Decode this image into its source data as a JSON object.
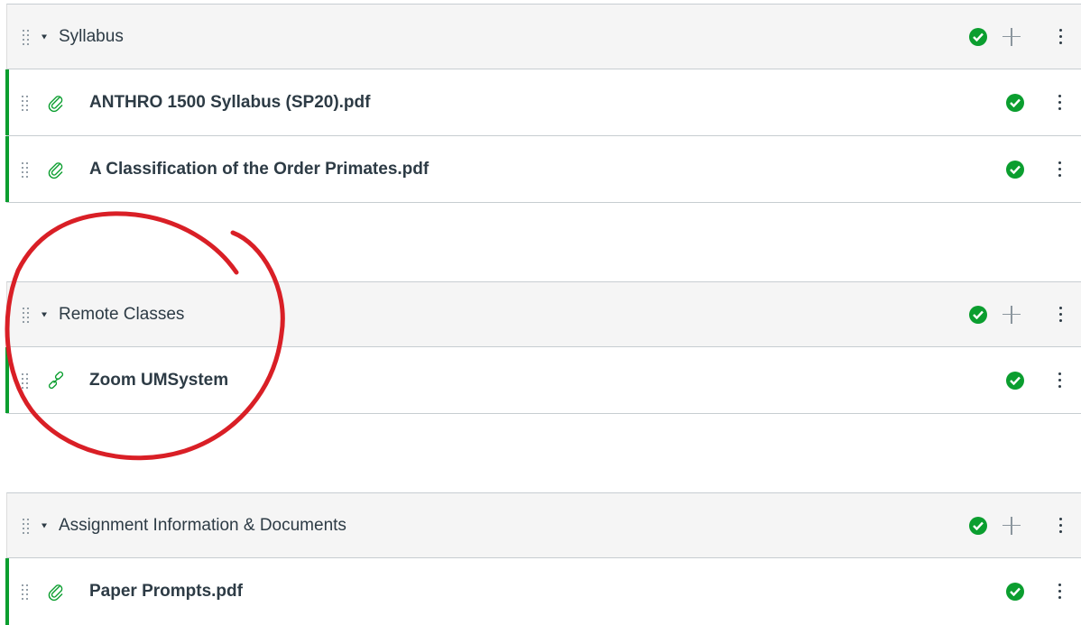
{
  "modules": [
    {
      "title": "Syllabus",
      "items": [
        {
          "title": "ANTHRO 1500 Syllabus (SP20).pdf",
          "icon": "paperclip-icon"
        },
        {
          "title": "A Classification of the Order Primates.pdf",
          "icon": "paperclip-icon"
        }
      ]
    },
    {
      "title": "Remote Classes",
      "items": [
        {
          "title": "Zoom UMSystem",
          "icon": "link-icon"
        }
      ]
    },
    {
      "title": "Assignment Information & Documents",
      "items": [
        {
          "title": "Paper Prompts.pdf",
          "icon": "paperclip-icon"
        }
      ]
    }
  ],
  "colors": {
    "published": "#0b9e2f",
    "header_bg": "#f5f5f5",
    "text": "#2d3b45",
    "annotation": "#d91f26"
  }
}
